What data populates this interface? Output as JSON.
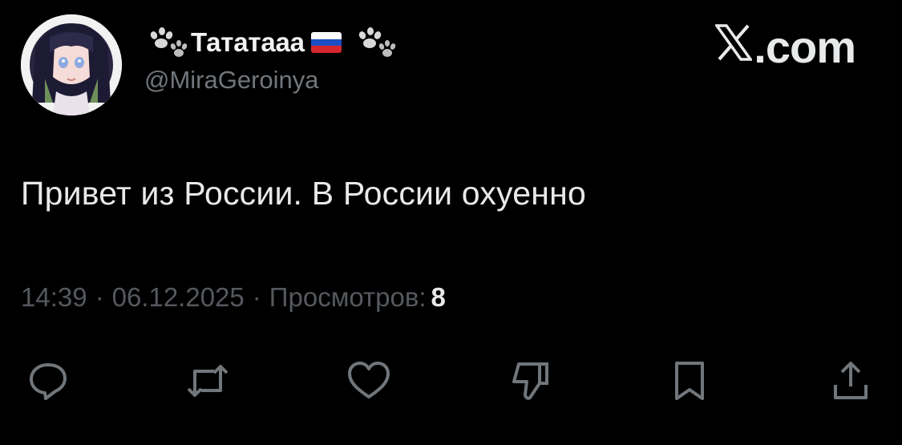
{
  "author": {
    "display_name": "Тататааа",
    "handle": "@MiraGeroinya",
    "flag": "russia-flag",
    "decorations": [
      "paw-icon",
      "paw-icon"
    ]
  },
  "brand": {
    "logo": "x-logo",
    "domain": ".com"
  },
  "tweet": {
    "text": "Привет из России. В России охуенно",
    "time": "14:39",
    "date": "06.12.2025",
    "separator": "·",
    "views_label": "Просмотров:",
    "views_count": "8"
  },
  "actions": [
    {
      "name": "reply",
      "icon": "reply-icon"
    },
    {
      "name": "repost",
      "icon": "repost-icon"
    },
    {
      "name": "like",
      "icon": "heart-icon"
    },
    {
      "name": "dislike",
      "icon": "thumbs-down-icon"
    },
    {
      "name": "bookmark",
      "icon": "bookmark-icon"
    },
    {
      "name": "share",
      "icon": "share-icon"
    }
  ],
  "colors": {
    "background": "#000000",
    "text_primary": "#e7e9ea",
    "text_secondary": "#71767b",
    "meta": "#55595e",
    "icon": "#71767b"
  }
}
